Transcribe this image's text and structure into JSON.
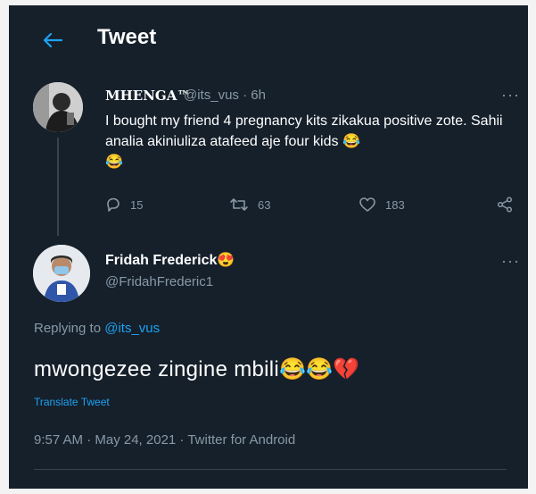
{
  "header": {
    "title": "Tweet"
  },
  "quoted_tweet": {
    "author_name": "MHENGA™",
    "handle_time": "@its_vus · 6h",
    "text": "I bought my friend 4 pregnancy kits zikakua positive zote. Sahii analia akiniuliza atafeed aje four kids",
    "emoji_1": "😂",
    "emoji_2": "😂",
    "replies": "15",
    "retweets": "63",
    "likes": "183"
  },
  "reply": {
    "author_name": "Fridah Frederick",
    "author_emoji": "😍",
    "handle": "@FridahFrederic1",
    "replying_prefix": "Replying to ",
    "replying_handle": "@its_vus",
    "text": "mwongezee zingine mbili",
    "emojis": "😂😂💔",
    "translate": "Translate Tweet",
    "meta": "9:57 AM · May 24, 2021 · Twitter for Android"
  },
  "colors": {
    "background": "#15202b",
    "accent": "#1da1f2",
    "muted": "#8899a6"
  }
}
